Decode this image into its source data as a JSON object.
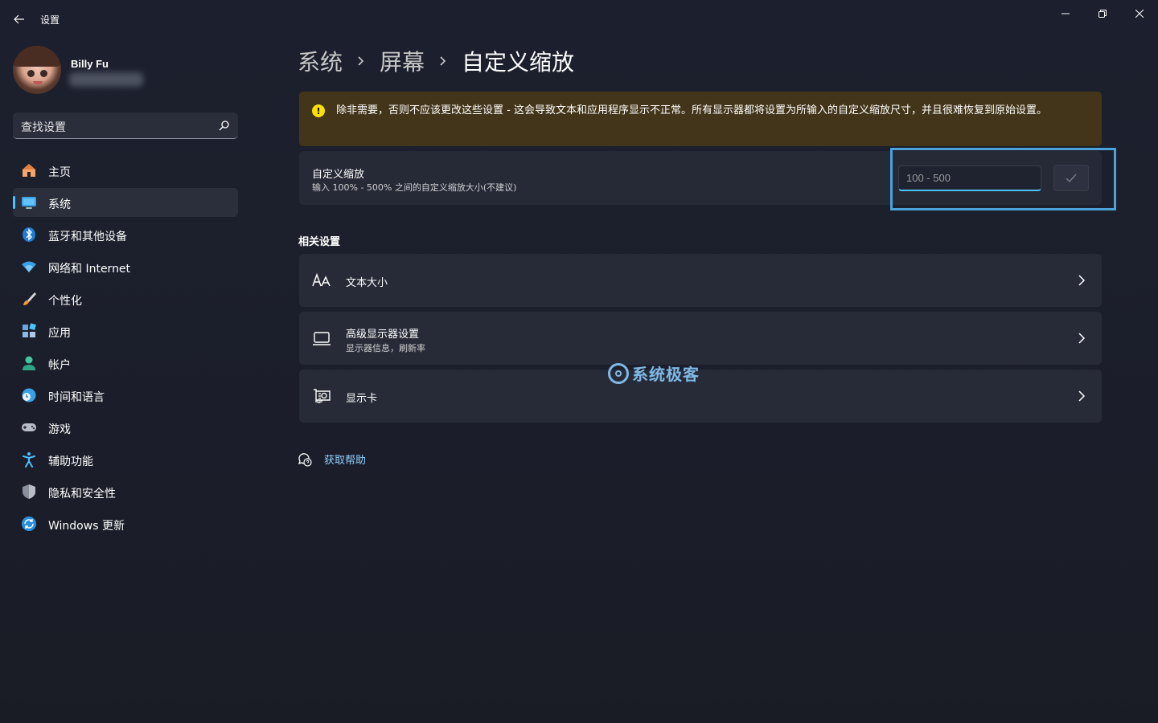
{
  "titlebar": {
    "app_title": "设置",
    "back_icon": "back-arrow-icon",
    "min_icon": "minimize-icon",
    "max_icon": "restore-icon",
    "close_icon": "close-icon"
  },
  "profile": {
    "name": "Billy Fu"
  },
  "search": {
    "placeholder": "查找设置",
    "icon": "search-icon"
  },
  "sidebar": {
    "active_index": 1,
    "accent": "#4cc2ff",
    "items": [
      {
        "label": "主页",
        "icon": "home-icon"
      },
      {
        "label": "系统",
        "icon": "system-monitor-icon"
      },
      {
        "label": "蓝牙和其他设备",
        "icon": "bluetooth-icon"
      },
      {
        "label": "网络和 Internet",
        "icon": "wifi-icon"
      },
      {
        "label": "个性化",
        "icon": "brush-icon"
      },
      {
        "label": "应用",
        "icon": "apps-icon"
      },
      {
        "label": "帐户",
        "icon": "account-icon"
      },
      {
        "label": "时间和语言",
        "icon": "globe-clock-icon"
      },
      {
        "label": "游戏",
        "icon": "gamepad-icon"
      },
      {
        "label": "辅助功能",
        "icon": "accessibility-icon"
      },
      {
        "label": "隐私和安全性",
        "icon": "shield-icon"
      },
      {
        "label": "Windows 更新",
        "icon": "update-icon"
      }
    ]
  },
  "breadcrumb": {
    "items": [
      "系统",
      "屏幕",
      "自定义缩放"
    ],
    "separator_icon": "chevron-right-icon"
  },
  "warning": {
    "icon": "warning-icon",
    "text": "除非需要，否则不应该更改这些设置 - 这会导致文本和应用程序显示不正常。所有显示器都将设置为所输入的自定义缩放尺寸，并且很难恢复到原始设置。",
    "color": "#fce100"
  },
  "custom_scaling": {
    "title": "自定义缩放",
    "subtitle": "输入 100% - 500% 之间的自定义缩放大小(不建议)",
    "input_placeholder": "100 - 500",
    "confirm_icon": "checkmark-icon"
  },
  "related": {
    "title": "相关设置",
    "items": [
      {
        "title": "文本大小",
        "subtitle": "",
        "icon": "text-size-icon"
      },
      {
        "title": "高级显示器设置",
        "subtitle": "显示器信息，刷新率",
        "icon": "laptop-icon"
      },
      {
        "title": "显示卡",
        "subtitle": "",
        "icon": "graphics-card-icon"
      }
    ]
  },
  "watermark": {
    "text": "系统极客"
  },
  "help": {
    "label": "获取帮助",
    "icon": "help-chat-icon"
  }
}
